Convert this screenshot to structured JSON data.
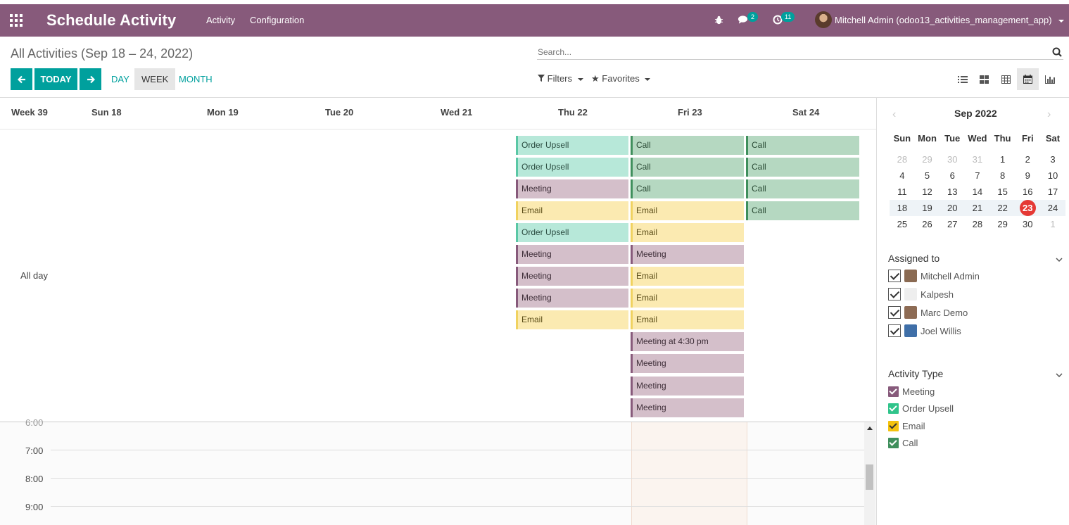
{
  "navbar": {
    "app_title": "Schedule Activity",
    "menu": [
      "Activity",
      "Configuration"
    ],
    "messages_count": "2",
    "activities_count": "11",
    "user": "Mitchell Admin (odoo13_activities_management_app)",
    "bg_color": "#875a7b"
  },
  "control": {
    "title": "All Activities (Sep 18 – 24, 2022)",
    "search_placeholder": "Search...",
    "today": "TODAY",
    "ranges": [
      "DAY",
      "WEEK",
      "MONTH"
    ],
    "active_range": "WEEK",
    "filters": "Filters",
    "favorites": "Favorites",
    "views": [
      "list-icon",
      "kanban-icon",
      "grid-icon",
      "calendar-icon",
      "graph-icon"
    ],
    "active_view": "calendar-icon"
  },
  "calendar": {
    "week_label": "Week 39",
    "days": [
      "Sun 18",
      "Mon 19",
      "Tue 20",
      "Wed 21",
      "Thu 22",
      "Fri 23",
      "Sat 24"
    ],
    "all_day": "All day",
    "times": [
      "6:00",
      "7:00",
      "8:00",
      "9:00"
    ],
    "events": {
      "thu": [
        {
          "type": "upsell",
          "label": "Order Upsell"
        },
        {
          "type": "upsell",
          "label": "Order Upsell"
        },
        {
          "type": "meeting",
          "label": "Meeting"
        },
        {
          "type": "email",
          "label": "Email"
        },
        {
          "type": "upsell",
          "label": "Order Upsell"
        },
        {
          "type": "meeting",
          "label": "Meeting"
        },
        {
          "type": "meeting",
          "label": "Meeting"
        },
        {
          "type": "meeting",
          "label": "Meeting"
        },
        {
          "type": "email",
          "label": "Email"
        }
      ],
      "fri": [
        {
          "type": "call",
          "label": "Call"
        },
        {
          "type": "call",
          "label": "Call"
        },
        {
          "type": "call",
          "label": "Call"
        },
        {
          "type": "email",
          "label": "Email"
        },
        {
          "type": "email",
          "label": "Email"
        },
        {
          "type": "meeting",
          "label": "Meeting"
        },
        {
          "type": "email",
          "label": "Email"
        },
        {
          "type": "email",
          "label": "Email"
        },
        {
          "type": "email",
          "label": "Email"
        },
        {
          "type": "meeting",
          "label": "Meeting at 4:30 pm"
        },
        {
          "type": "meeting",
          "label": "Meeting"
        },
        {
          "type": "meeting",
          "label": "Meeting"
        },
        {
          "type": "meeting",
          "label": "Meeting"
        }
      ],
      "sat": [
        {
          "type": "call",
          "label": "Call"
        },
        {
          "type": "call",
          "label": "Call"
        },
        {
          "type": "call",
          "label": "Call"
        },
        {
          "type": "call",
          "label": "Call"
        }
      ]
    }
  },
  "sidebar": {
    "month_title": "Sep 2022",
    "weekdays": [
      "Sun",
      "Mon",
      "Tue",
      "Wed",
      "Thu",
      "Fri",
      "Sat"
    ],
    "weeks": [
      [
        "28",
        "29",
        "30",
        "31",
        "1",
        "2",
        "3"
      ],
      [
        "4",
        "5",
        "6",
        "7",
        "8",
        "9",
        "10"
      ],
      [
        "11",
        "12",
        "13",
        "14",
        "15",
        "16",
        "17"
      ],
      [
        "18",
        "19",
        "20",
        "21",
        "22",
        "23",
        "24"
      ],
      [
        "25",
        "26",
        "27",
        "28",
        "29",
        "30",
        "1"
      ]
    ],
    "today": "23",
    "assigned_title": "Assigned to",
    "assigned": [
      "Mitchell Admin",
      "Kalpesh",
      "Marc Demo",
      "Joel Willis"
    ],
    "type_title": "Activity Type",
    "types": [
      {
        "label": "Meeting",
        "color": "#875a7b"
      },
      {
        "label": "Order Upsell",
        "color": "#30c48b"
      },
      {
        "label": "Email",
        "color": "#f4c20d"
      },
      {
        "label": "Call",
        "color": "#3f8f5c"
      }
    ]
  }
}
